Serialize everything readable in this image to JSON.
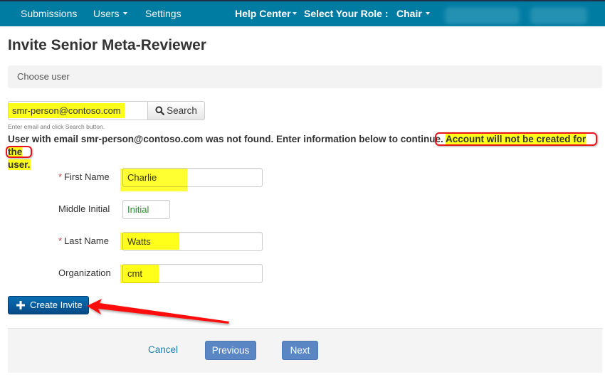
{
  "navbar": {
    "items": [
      {
        "label": "Submissions",
        "dropdown": false
      },
      {
        "label": "Users",
        "dropdown": true
      },
      {
        "label": "Settings",
        "dropdown": false
      }
    ],
    "help_center": "Help Center",
    "role_label": "Select Your Role :",
    "role_value": "Chair",
    "bg_color": "#007ca3"
  },
  "page": {
    "title": "Invite Senior Meta-Reviewer",
    "section_heading": "Choose user"
  },
  "search": {
    "email_value": "smr-person@contoso.com",
    "button_label": "Search",
    "help_text": "Enter email and click Search button."
  },
  "message": {
    "not_found": "User with email smr-person@contoso.com was not found. Enter information below to continue.",
    "warning_part1": "Account will not be created for the",
    "warning_part2": "user."
  },
  "form": {
    "required_marker": "*",
    "first_name": {
      "label": "First Name",
      "value": "Charlie",
      "required": true
    },
    "middle_initial": {
      "label": "Middle Initial",
      "value": "Initial",
      "required": false
    },
    "last_name": {
      "label": "Last Name",
      "value": "Watts",
      "required": true
    },
    "organization": {
      "label": "Organization",
      "value": "cmt",
      "required": false
    }
  },
  "actions": {
    "create_invite": "Create Invite",
    "cancel": "Cancel",
    "previous": "Previous",
    "next": "Next"
  },
  "annotations": {
    "highlight_color": "#ffff1a",
    "ring_color": "#e8131b",
    "arrow_color": "#ff0000"
  }
}
